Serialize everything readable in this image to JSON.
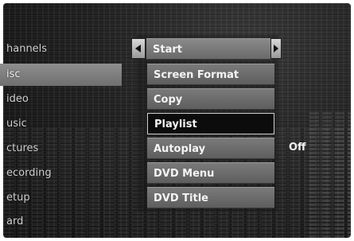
{
  "sidebar": {
    "items": [
      {
        "label": "hannels"
      },
      {
        "label": "isc",
        "selected": true
      },
      {
        "label": "ideo"
      },
      {
        "label": "usic"
      },
      {
        "label": "ctures"
      },
      {
        "label": "ecording"
      },
      {
        "label": "etup"
      },
      {
        "label": "ard"
      }
    ]
  },
  "submenu": {
    "items": [
      {
        "label": "Start",
        "header": true
      },
      {
        "label": "Screen Format"
      },
      {
        "label": "Copy"
      },
      {
        "label": "Playlist",
        "focused": true
      },
      {
        "label": "Autoplay",
        "value": "Off"
      },
      {
        "label": "DVD Menu"
      },
      {
        "label": "DVD Title"
      }
    ]
  },
  "icons": {
    "left_arrow": "arrow-left-icon",
    "right_arrow": "arrow-right-icon"
  },
  "colors": {
    "focus_bg": "#0c0c0c",
    "focus_border": "#d0d0d0",
    "item_bg": "#6a6a6a"
  }
}
